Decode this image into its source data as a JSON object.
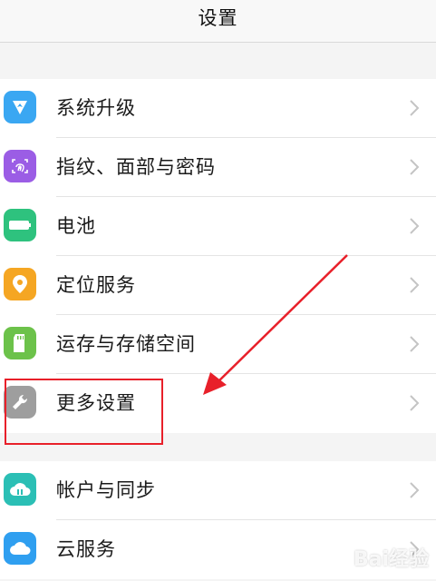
{
  "header": {
    "title": "设置"
  },
  "section1": {
    "items": [
      {
        "label": "系统升级",
        "icon": "system-update-icon",
        "color": "#3aa7f2"
      },
      {
        "label": "指纹、面部与密码",
        "icon": "fingerprint-icon",
        "color": "#9b5de5"
      },
      {
        "label": "电池",
        "icon": "battery-icon",
        "color": "#2ec27e"
      },
      {
        "label": "定位服务",
        "icon": "location-icon",
        "color": "#f5a623"
      },
      {
        "label": "运存与存储空间",
        "icon": "storage-icon",
        "color": "#6cc24a"
      },
      {
        "label": "更多设置",
        "icon": "wrench-icon",
        "color": "#9e9e9e"
      }
    ]
  },
  "section2": {
    "items": [
      {
        "label": "帐户与同步",
        "icon": "cloud-sync-icon",
        "color": "#2bbfb5"
      },
      {
        "label": "云服务",
        "icon": "cloud-icon",
        "color": "#2f9ff0"
      }
    ]
  },
  "annotation": {
    "highlight_color": "#e8202a"
  },
  "watermark": {
    "text": "Bai经验"
  }
}
